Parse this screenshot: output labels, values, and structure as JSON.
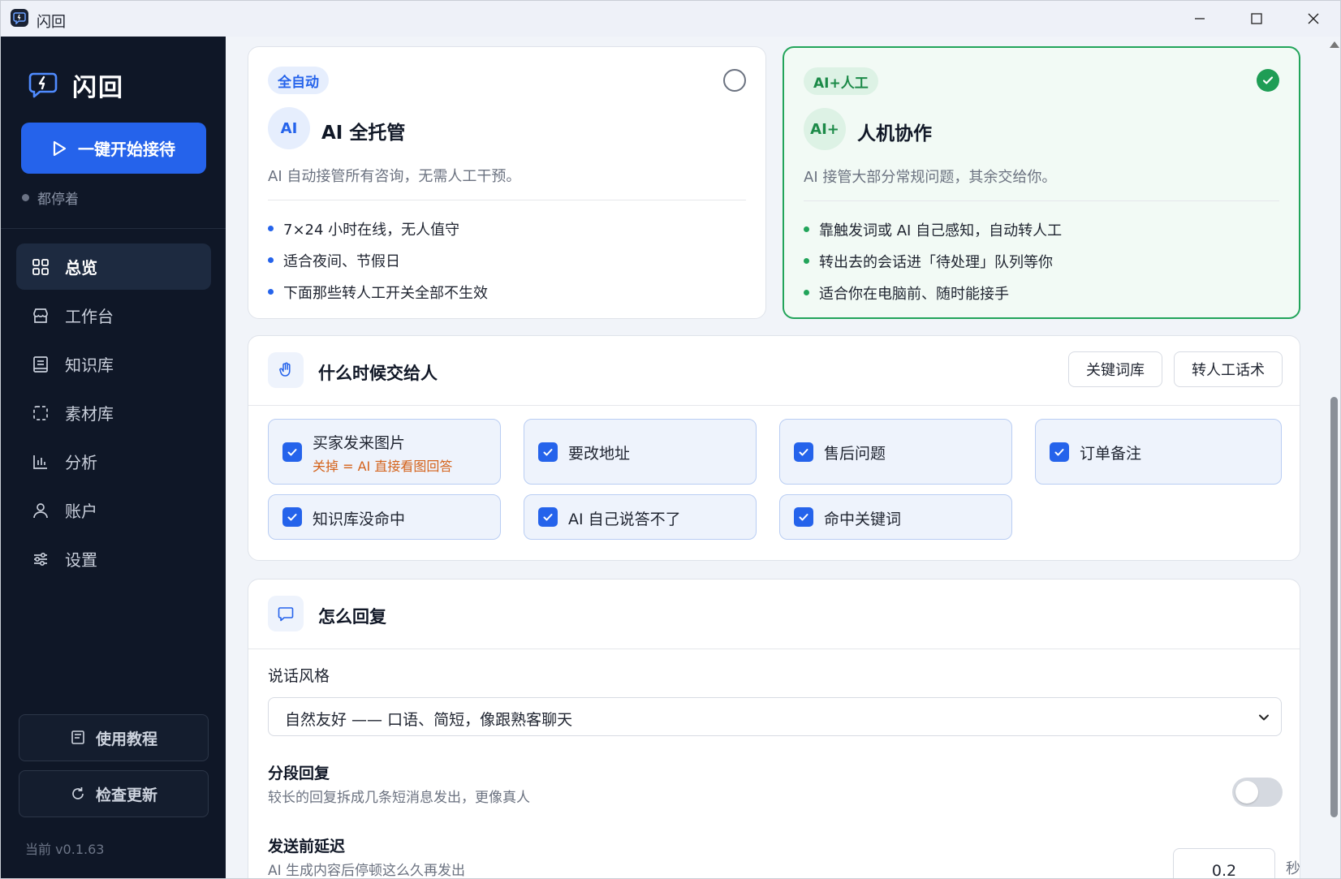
{
  "window": {
    "title": "闪回"
  },
  "sidebar": {
    "brand": "闪回",
    "start_button": "一键开始接待",
    "status": "都停着",
    "nav": [
      {
        "label": "总览",
        "icon": "grid-icon"
      },
      {
        "label": "工作台",
        "icon": "store-icon"
      },
      {
        "label": "知识库",
        "icon": "book-icon"
      },
      {
        "label": "素材库",
        "icon": "dashed-square-icon"
      },
      {
        "label": "分析",
        "icon": "bar-chart-icon"
      },
      {
        "label": "账户",
        "icon": "user-icon"
      },
      {
        "label": "设置",
        "icon": "sliders-icon"
      }
    ],
    "tutorial_button": "使用教程",
    "update_button": "检查更新",
    "version": "当前 v0.1.63"
  },
  "modes": [
    {
      "tag": "全自动",
      "avatar": "AI",
      "title": "AI 全托管",
      "desc": "AI 自动接管所有咨询，无需人工干预。",
      "points": [
        "7×24 小时在线，无人值守",
        "适合夜间、节假日",
        "下面那些转人工开关全部不生效"
      ],
      "selected": false
    },
    {
      "tag": "AI+人工",
      "avatar": "AI+",
      "title": "人机协作",
      "desc": "AI 接管大部分常规问题，其余交给你。",
      "points": [
        "靠触发词或 AI 自己感知，自动转人工",
        "转出去的会话进「待处理」队列等你",
        "适合你在电脑前、随时能接手"
      ],
      "selected": true
    }
  ],
  "handoff": {
    "title": "什么时候交给人",
    "keyword_button": "关键词库",
    "script_button": "转人工话术",
    "options": [
      {
        "label": "买家发来图片",
        "sub": "关掉 = AI 直接看图回答",
        "checked": true
      },
      {
        "label": "要改地址",
        "checked": true
      },
      {
        "label": "售后问题",
        "checked": true
      },
      {
        "label": "订单备注",
        "checked": true
      },
      {
        "label": "知识库没命中",
        "checked": true
      },
      {
        "label": "AI 自己说答不了",
        "checked": true
      },
      {
        "label": "命中关键词",
        "checked": true
      }
    ]
  },
  "reply": {
    "title": "怎么回复",
    "style_label": "说话风格",
    "style_value": "自然友好 —— 口语、简短，像跟熟客聊天",
    "segment_title": "分段回复",
    "segment_desc": "较长的回复拆成几条短消息发出，更像真人",
    "segment_on": false,
    "delay_title": "发送前延迟",
    "delay_desc": "AI 生成内容后停顿这么久再发出",
    "delay_value": "0.2",
    "delay_unit": "秒"
  },
  "colors": {
    "sidebar_bg": "#0f1727",
    "accent": "#2563eb",
    "success": "#22a45a",
    "warning_text": "#d4621a"
  }
}
